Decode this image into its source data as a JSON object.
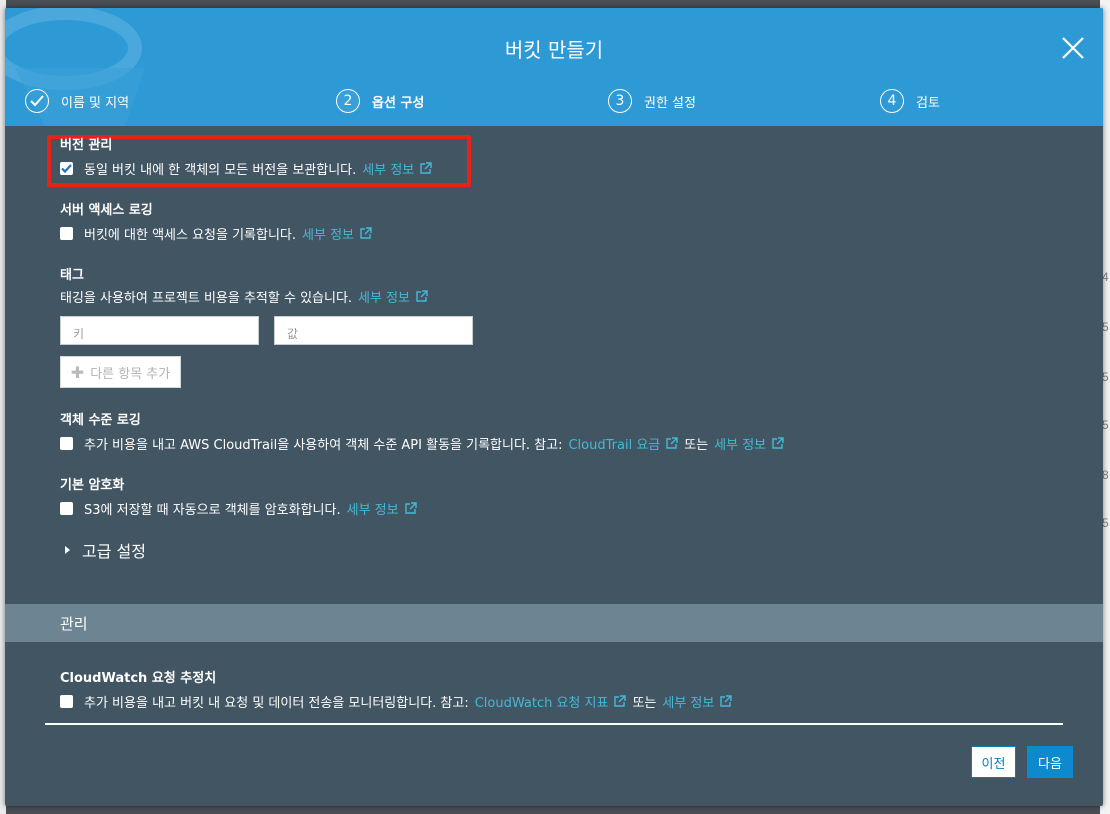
{
  "modal": {
    "title": "버킷 만들기",
    "steps": [
      {
        "number": "",
        "label": "이름 및 지역",
        "state": "completed"
      },
      {
        "number": "2",
        "label": "옵션 구성",
        "state": "active"
      },
      {
        "number": "3",
        "label": "권한 설정",
        "state": "pending"
      },
      {
        "number": "4",
        "label": "검토",
        "state": "pending"
      }
    ]
  },
  "versioning": {
    "title": "버전 관리",
    "text": "동일 버킷 내에 한 객체의 모든 버전을 보관합니다.",
    "link": "세부 정보",
    "checked": true
  },
  "access_logging": {
    "title": "서버 액세스 로깅",
    "text": "버킷에 대한 액세스 요청을 기록합니다.",
    "link": "세부 정보",
    "checked": false
  },
  "tags": {
    "title": "태그",
    "text": "태깅을 사용하여 프로젝트 비용을 추적할 수 있습니다.",
    "link": "세부 정보",
    "key_placeholder": "키",
    "value_placeholder": "값",
    "add_label": "다른 항목 추가"
  },
  "object_logging": {
    "title": "객체 수준 로깅",
    "text": "추가 비용을 내고 AWS CloudTrail을 사용하여 객체 수준 API 활동을 기록합니다. 참고:",
    "link1": "CloudTrail 요금",
    "or": "또는",
    "link2": "세부 정보",
    "checked": false
  },
  "encryption": {
    "title": "기본 암호화",
    "text": "S3에 저장할 때 자동으로 객체를 암호화합니다.",
    "link": "세부 정보",
    "checked": false
  },
  "advanced": {
    "label": "고급 설정"
  },
  "management": {
    "section_label": "관리",
    "title": "CloudWatch 요청 추정치",
    "text": "추가 비용을 내고 버킷 내 요청 및 데이터 전송을 모니터링합니다. 참고:",
    "link1": "CloudWatch 요청 지표",
    "or": "또는",
    "link2": "세부 정보",
    "checked": false
  },
  "buttons": {
    "prev": "이전",
    "next": "다음"
  },
  "background_digits": [
    "4",
    "5",
    "5",
    "5",
    "8",
    "5"
  ],
  "colors": {
    "header": "#2e9ad5",
    "body": "#425563",
    "link": "#44b9d6",
    "highlight": "#e8221b",
    "primary": "#0d89ce"
  }
}
